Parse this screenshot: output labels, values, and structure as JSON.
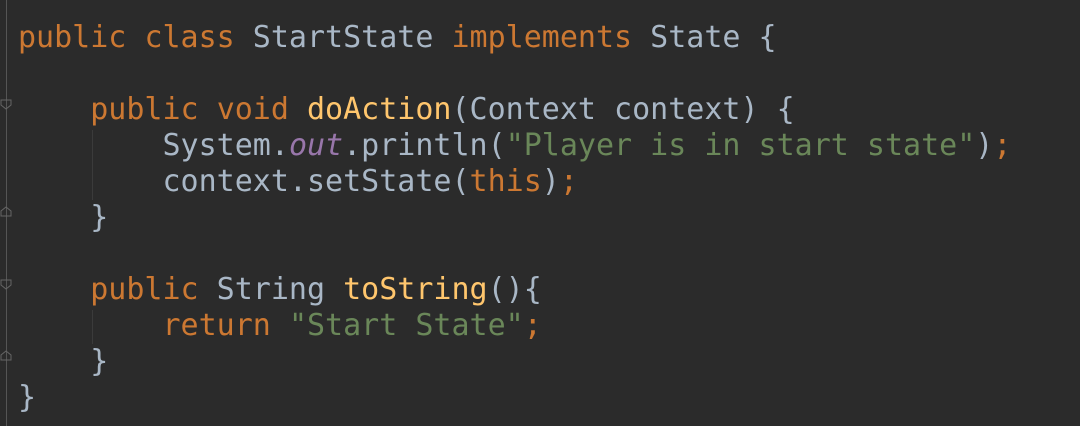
{
  "editor": {
    "lines": [
      {
        "tokens": [
          {
            "t": "public",
            "c": "kw"
          },
          {
            "t": " "
          },
          {
            "t": "class",
            "c": "kw"
          },
          {
            "t": " StartState "
          },
          {
            "t": "implements",
            "c": "kw"
          },
          {
            "t": " State {"
          }
        ]
      },
      {
        "tokens": []
      },
      {
        "tokens": [
          {
            "t": "    "
          },
          {
            "t": "public",
            "c": "kw"
          },
          {
            "t": " "
          },
          {
            "t": "void",
            "c": "kw"
          },
          {
            "t": " "
          },
          {
            "t": "doAction",
            "c": "fn"
          },
          {
            "t": "(Context context) {"
          }
        ]
      },
      {
        "tokens": [
          {
            "t": "        System."
          },
          {
            "t": "out",
            "c": "field"
          },
          {
            "t": ".println("
          },
          {
            "t": "\"Player is in start state\"",
            "c": "str"
          },
          {
            "t": ")"
          },
          {
            "t": ";",
            "c": "punct"
          }
        ]
      },
      {
        "tokens": [
          {
            "t": "        context.setState("
          },
          {
            "t": "this",
            "c": "kw"
          },
          {
            "t": ")"
          },
          {
            "t": ";",
            "c": "punct"
          }
        ]
      },
      {
        "tokens": [
          {
            "t": "    }"
          }
        ]
      },
      {
        "tokens": []
      },
      {
        "tokens": [
          {
            "t": "    "
          },
          {
            "t": "public",
            "c": "kw"
          },
          {
            "t": " String "
          },
          {
            "t": "toString",
            "c": "fn"
          },
          {
            "t": "(){"
          }
        ]
      },
      {
        "tokens": [
          {
            "t": "        "
          },
          {
            "t": "return",
            "c": "kw"
          },
          {
            "t": " "
          },
          {
            "t": "\"Start State\"",
            "c": "str"
          },
          {
            "t": ";",
            "c": "punct"
          }
        ]
      },
      {
        "tokens": [
          {
            "t": "    }"
          }
        ]
      },
      {
        "tokens": [
          {
            "t": "}"
          }
        ]
      }
    ]
  }
}
